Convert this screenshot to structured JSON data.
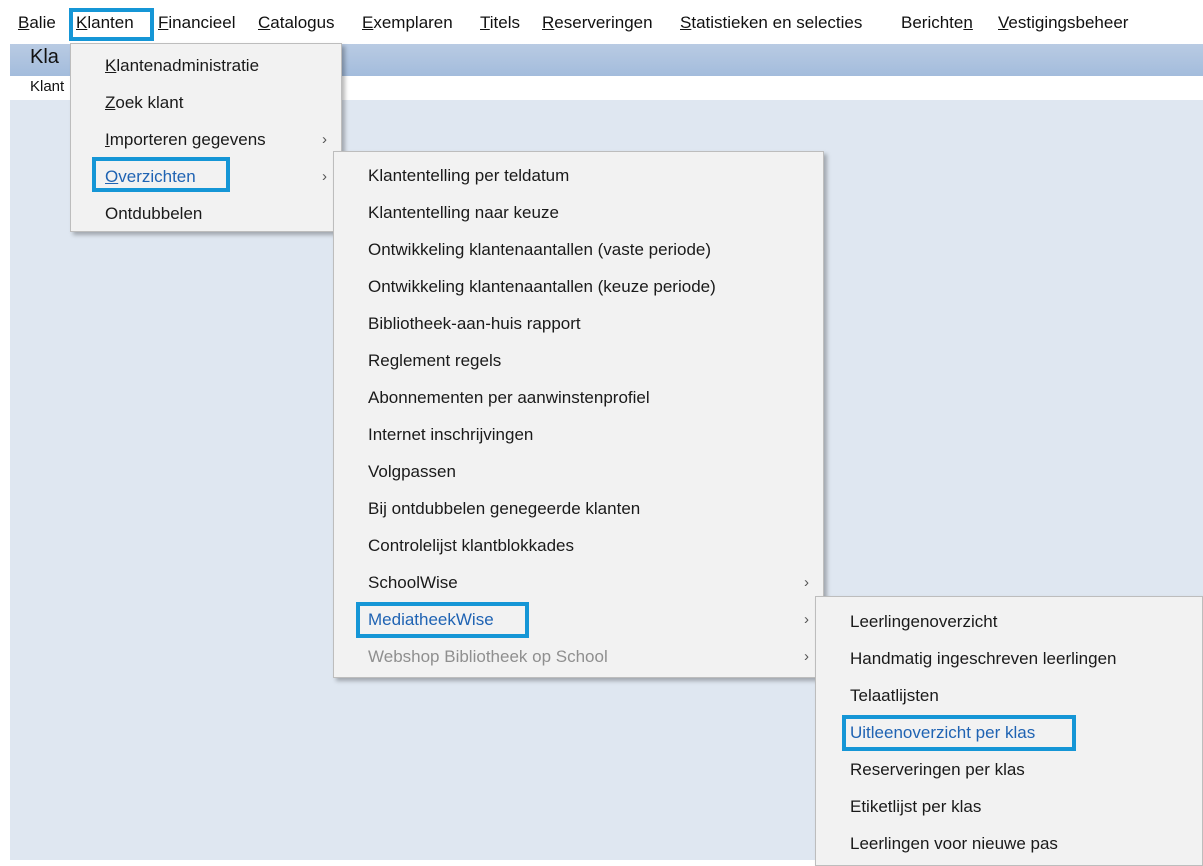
{
  "menubar": {
    "items": [
      {
        "label": "Balie",
        "accel_index": 0
      },
      {
        "label": "Klanten",
        "accel_index": 0
      },
      {
        "label": "Financieel",
        "accel_index": 0
      },
      {
        "label": "Catalogus",
        "accel_index": 0
      },
      {
        "label": "Exemplaren",
        "accel_index": 0
      },
      {
        "label": "Titels",
        "accel_index": 0
      },
      {
        "label": "Reserveringen",
        "accel_index": 0
      },
      {
        "label": "Statistieken en selecties",
        "accel_index": 0
      },
      {
        "label": "Berichten",
        "accel_index": 8
      },
      {
        "label": "Vestigingsbeheer",
        "accel_index": 0
      }
    ]
  },
  "background": {
    "title": "Kla",
    "subtitle": "Klant"
  },
  "klanten_menu": {
    "items": [
      {
        "label": "Klantenadministratie",
        "submenu": false
      },
      {
        "label": "Zoek klant",
        "submenu": false
      },
      {
        "label": "Importeren gegevens",
        "submenu": true
      },
      {
        "label": "Overzichten",
        "submenu": true,
        "selected": true
      },
      {
        "label": "Ontdubbelen",
        "submenu": false
      }
    ]
  },
  "overzichten_menu": {
    "items": [
      {
        "label": "Klantentelling per teldatum",
        "submenu": false
      },
      {
        "label": "Klantentelling naar keuze",
        "submenu": false
      },
      {
        "label": "Ontwikkeling klantenaantallen (vaste periode)",
        "submenu": false
      },
      {
        "label": "Ontwikkeling klantenaantallen (keuze periode)",
        "submenu": false
      },
      {
        "label": "Bibliotheek-aan-huis rapport",
        "submenu": false
      },
      {
        "label": "Reglement regels",
        "submenu": false
      },
      {
        "label": "Abonnementen per aanwinstenprofiel",
        "submenu": false
      },
      {
        "label": "Internet inschrijvingen",
        "submenu": false
      },
      {
        "label": "Volgpassen",
        "submenu": false
      },
      {
        "label": "Bij ontdubbelen genegeerde klanten",
        "submenu": false
      },
      {
        "label": "Controlelijst klantblokkades",
        "submenu": false
      },
      {
        "label": "SchoolWise",
        "submenu": true
      },
      {
        "label": "MediatheekWise",
        "submenu": true,
        "selected": true
      },
      {
        "label": "Webshop Bibliotheek op School",
        "submenu": true,
        "disabled": true
      }
    ]
  },
  "mediatheek_menu": {
    "items": [
      {
        "label": "Leerlingenoverzicht",
        "submenu": false
      },
      {
        "label": "Handmatig ingeschreven leerlingen",
        "submenu": false
      },
      {
        "label": "Telaatlijsten",
        "submenu": false
      },
      {
        "label": "Uitleenoverzicht per klas",
        "submenu": false,
        "selected": true
      },
      {
        "label": "Reserveringen per klas",
        "submenu": false
      },
      {
        "label": "Etiketlijst per klas",
        "submenu": false
      },
      {
        "label": "Leerlingen voor nieuwe pas",
        "submenu": false
      }
    ]
  },
  "colors": {
    "highlight_border": "#1596d6",
    "selected_text": "#1f63b3",
    "menu_bg": "#f2f2f2",
    "app_bg": "#dfe7f1"
  },
  "icons": {
    "submenu_arrow": "›"
  }
}
